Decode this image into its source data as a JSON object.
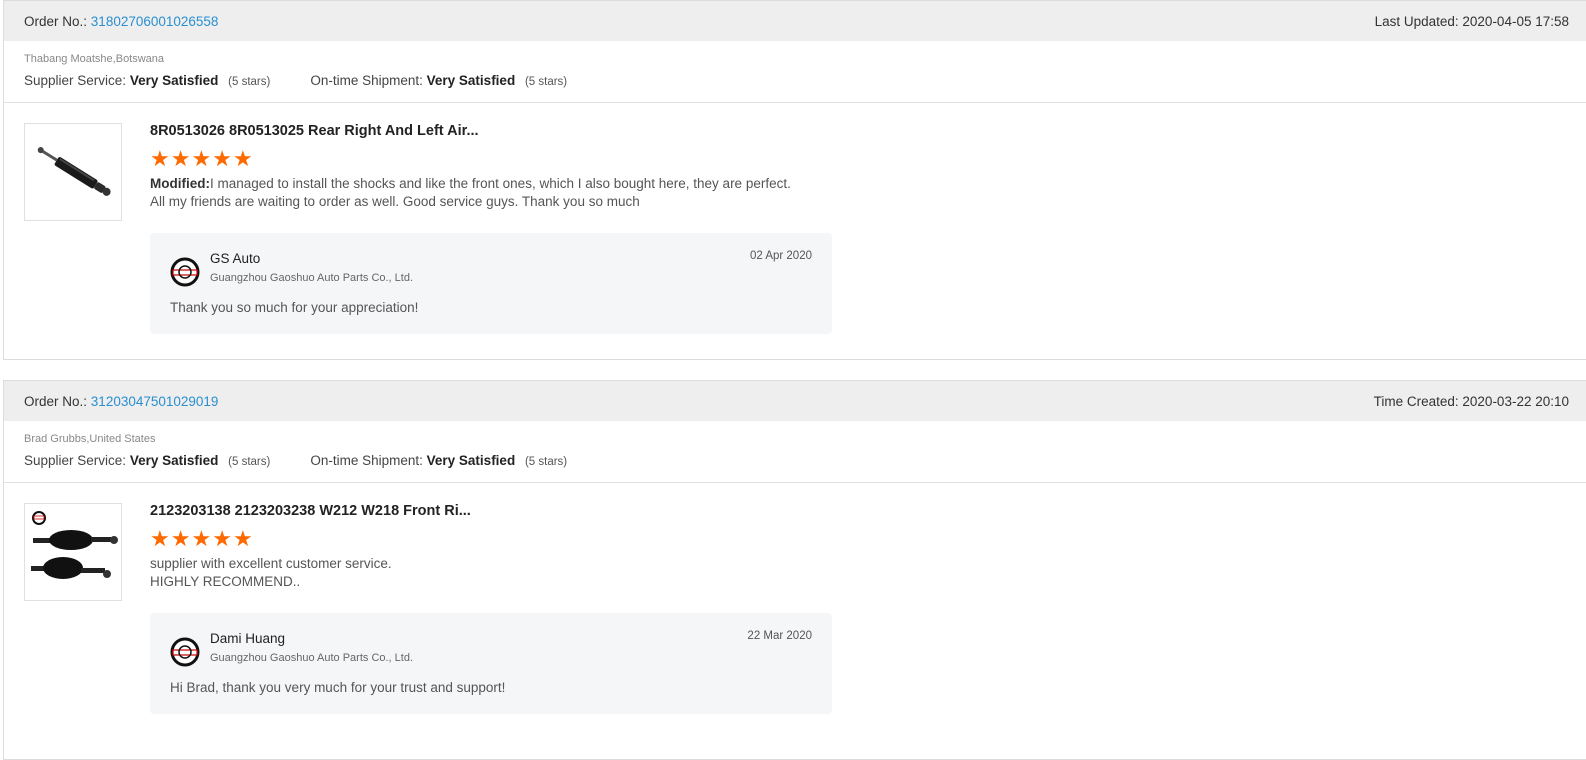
{
  "reviews": [
    {
      "order_label": "Order No.:",
      "order_no": "31802706001026558",
      "time_label": "Last Updated:",
      "time_value": "2020-04-05 17:58",
      "buyer": "Thabang Moatshe,Botswana",
      "supplier_service_label": "Supplier Service:",
      "supplier_service_value": "Very Satisfied",
      "supplier_service_stars": "(5 stars)",
      "shipment_label": "On-time Shipment:",
      "shipment_value": "Very Satisfied",
      "shipment_stars": "(5 stars)",
      "product_title": "8R0513026 8R0513025 Rear Right And Left Air...",
      "rating": 5,
      "comment_prefix": "Modified:",
      "comment_line1": "I managed to install the shocks and like the front ones, which I also bought here, they are perfect.",
      "comment_line2": "All my friends are waiting to order as well. Good service guys. Thank you so much",
      "reply_name": "GS Auto",
      "reply_company": "Guangzhou Gaoshuo Auto Parts Co., Ltd.",
      "reply_date": "02 Apr 2020",
      "reply_message": "Thank you so much for your appreciation!"
    },
    {
      "order_label": "Order No.:",
      "order_no": "31203047501029019",
      "time_label": "Time Created:",
      "time_value": "2020-03-22 20:10",
      "buyer": "Brad Grubbs,United States",
      "supplier_service_label": "Supplier Service:",
      "supplier_service_value": "Very Satisfied",
      "supplier_service_stars": "(5 stars)",
      "shipment_label": "On-time Shipment:",
      "shipment_value": "Very Satisfied",
      "shipment_stars": "(5 stars)",
      "product_title": "2123203138 2123203238 W212 W218 Front Ri...",
      "rating": 5,
      "comment_line1": "supplier with excellent customer service.",
      "comment_line2": "HIGHLY RECOMMEND..",
      "reply_name": "Dami Huang",
      "reply_company": "Guangzhou Gaoshuo Auto Parts Co., Ltd.",
      "reply_date": "22 Mar 2020",
      "reply_message": "Hi Brad, thank you very much for your trust and support!"
    }
  ],
  "colors": {
    "accent_link": "#2a8fd0",
    "star": "#ff6a00",
    "header_bg": "#eeeeee",
    "reply_bg": "#f5f6f8"
  }
}
